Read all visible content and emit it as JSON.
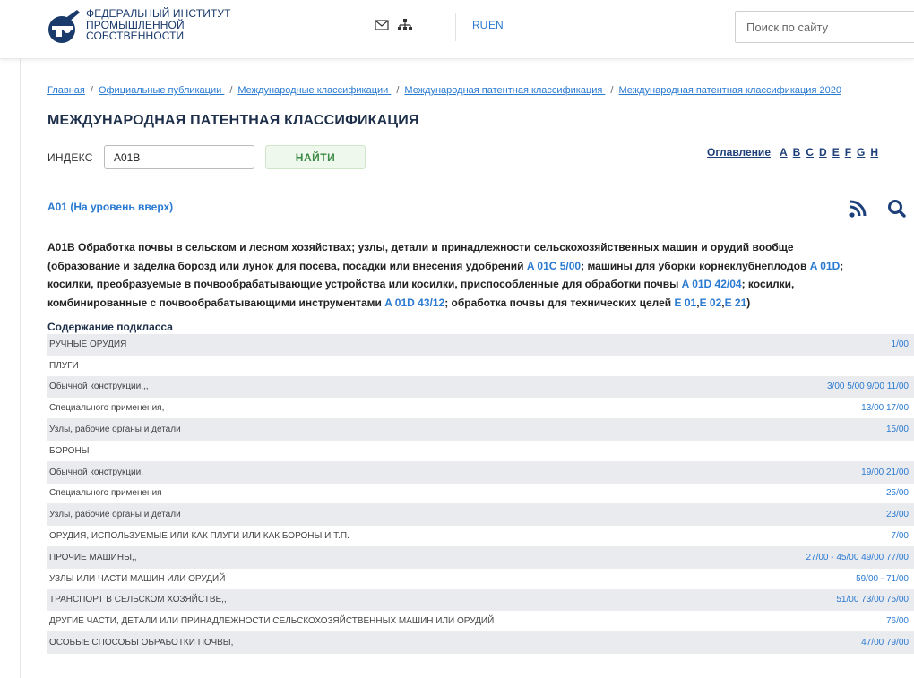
{
  "header": {
    "logo_lines": [
      "ФЕДЕРАЛЬНЫЙ ИНСТИТУТ",
      "ПРОМЫШЛЕННОЙ",
      "СОБСТВЕННОСТИ"
    ],
    "lang_ru": "RU",
    "lang_en": "EN",
    "search_placeholder": "Поиск по сайту"
  },
  "breadcrumb": [
    "Главная",
    "Официальные публикации ",
    "Международные классификации ",
    "Международная патентная классификация ",
    "Международная патентная классификация 2020"
  ],
  "page_title": "МЕЖДУНАРОДНАЯ ПАТЕНТНАЯ КЛАССИФИКАЦИЯ",
  "search_form": {
    "index_label": "ИНДЕКС",
    "index_value": "A01B",
    "find_button": "НАЙТИ"
  },
  "toc": {
    "main": "Оглавление",
    "letters": [
      "A",
      "B",
      "C",
      "D",
      "E",
      "F",
      "G",
      "H"
    ]
  },
  "up_link": "A01 (На уровень вверх)",
  "description": {
    "t1": "A01B Обработка почвы в сельском и лесном хозяйствах; узлы, детали и принадлежности сельскохозяйственных машин и орудий вообще (образование и заделка борозд или лунок для посева, посадки или внесения удобрений ",
    "l1": "A 01C 5/00",
    "t2": "; машины для уборки корнеклубнеплодов ",
    "l2": "A 01D",
    "t3": "; косилки, преобразуемые в почвообрабатывающие устройства или косилки, приспособленные для обработки почвы ",
    "l3": "A 01D 42/04",
    "t4": "; косилки, комбинированные с почвообрабатывающими инструментами ",
    "l4": "A 01D 43/12",
    "t5": "; обработка почвы для технических целей ",
    "l5": "E 01",
    "t6": ",",
    "l6": "E 02",
    "t7": ",",
    "l7": "E 21",
    "t8": ")"
  },
  "subclass_title": "Содержание подкласса",
  "rows": [
    {
      "label": "РУЧНЫЕ ОРУДИЯ",
      "code": "1/00"
    },
    {
      "label": "ПЛУГИ",
      "code": ""
    },
    {
      "label": "Обычной конструкции,,,",
      "code": "3/00 5/00 9/00 11/00"
    },
    {
      "label": "Специального применения,",
      "code": "13/00 17/00"
    },
    {
      "label": "Узлы, рабочие органы и детали",
      "code": "15/00"
    },
    {
      "label": "БОРОНЫ",
      "code": ""
    },
    {
      "label": "Обычной конструкции,",
      "code": "19/00 21/00"
    },
    {
      "label": "Специального применения",
      "code": "25/00"
    },
    {
      "label": "Узлы, рабочие органы и детали",
      "code": "23/00"
    },
    {
      "label": "ОРУДИЯ, ИСПОЛЬЗУЕМЫЕ ИЛИ КАК ПЛУГИ ИЛИ КАК БОРОНЫ И Т.П.",
      "code": "7/00"
    },
    {
      "label": "ПРОЧИЕ МАШИНЫ,,",
      "code": "27/00 - 45/00 49/00 77/00"
    },
    {
      "label": "УЗЛЫ ИЛИ ЧАСТИ МАШИН ИЛИ ОРУДИЙ",
      "code": "59/00 - 71/00"
    },
    {
      "label": "ТРАНСПОРТ В СЕЛЬСКОМ ХОЗЯЙСТВЕ,,",
      "code": "51/00 73/00 75/00"
    },
    {
      "label": "ДРУГИЕ ЧАСТИ, ДЕТАЛИ ИЛИ ПРИНАДЛЕЖНОСТИ СЕЛЬСКОХОЗЯЙСТВЕННЫХ МАШИН ИЛИ ОРУДИЙ",
      "code": "76/00"
    },
    {
      "label": "ОСОБЫЕ СПОСОБЫ ОБРАБОТКИ ПОЧВЫ,",
      "code": "47/00 79/00"
    }
  ]
}
